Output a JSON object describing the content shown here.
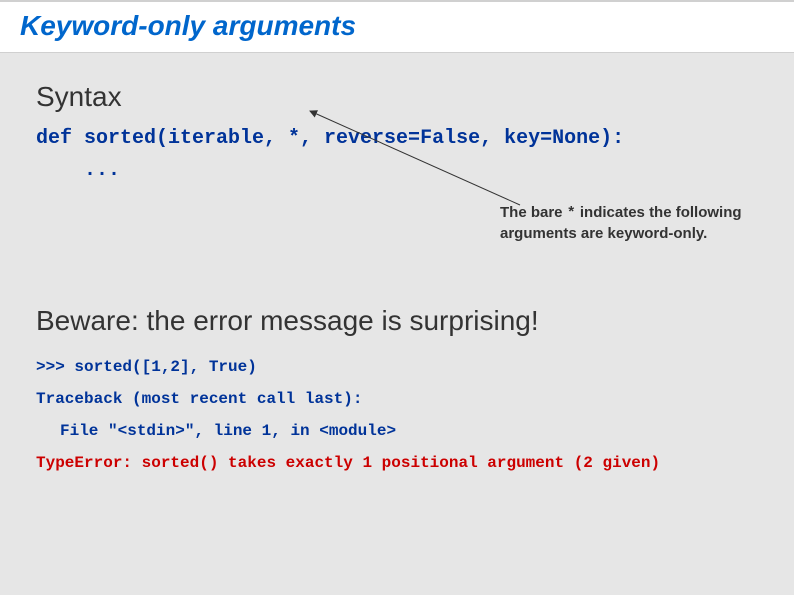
{
  "title": "Keyword-only arguments",
  "section1": {
    "heading": "Syntax",
    "code_line1": "def sorted(iterable, *, reverse=False, key=None):",
    "code_line2": "..."
  },
  "callout": {
    "part1": "The bare ",
    "star": "*",
    "part2": " indicates the following arguments are keyword-only."
  },
  "section2": {
    "heading": "Beware: the error message is surprising!",
    "line1": ">>> sorted([1,2], True)",
    "line2": "Traceback (most recent call last):",
    "line3": "File \"<stdin>\", line 1, in <module>",
    "line4": "TypeError: sorted() takes exactly 1 positional argument (2 given)"
  }
}
